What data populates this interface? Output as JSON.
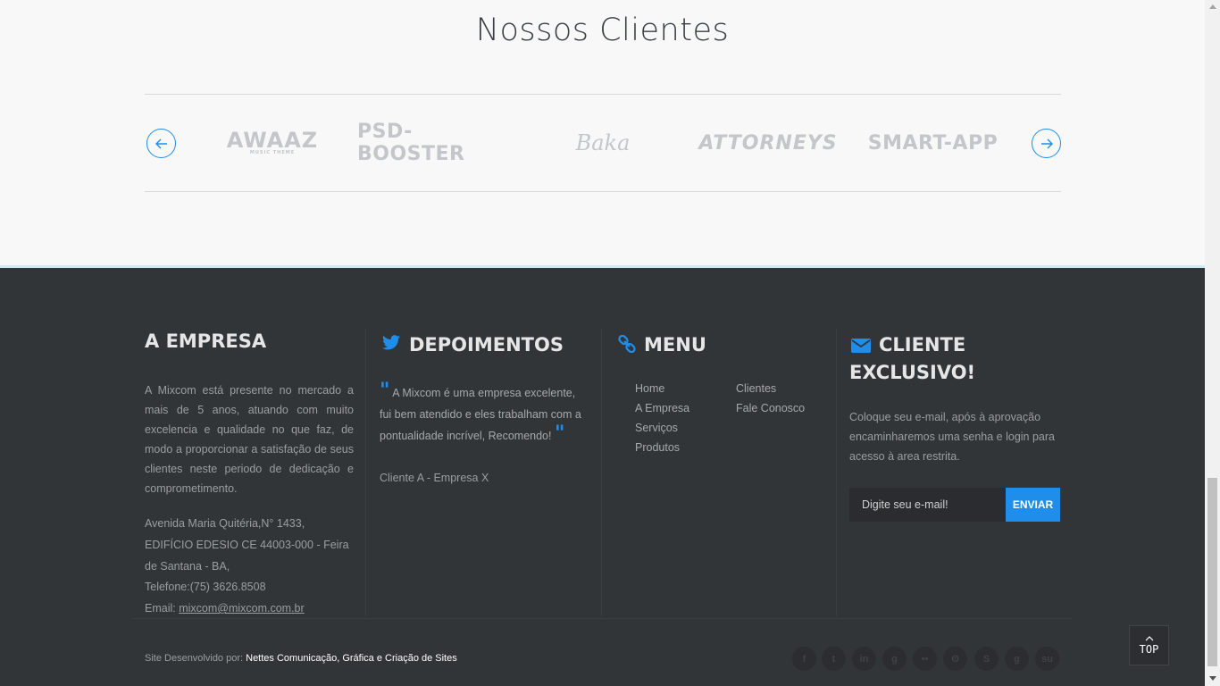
{
  "clients": {
    "title": "Nossos Clientes",
    "logos": {
      "awaaz": "AWAAZ",
      "awaaz_sub": "MUSIC THEME",
      "psd": "PSD-BOOSTER",
      "baka": "Baka",
      "attorneys": "ATTORNEYS",
      "smart": "SMART-APP"
    },
    "accent_color": "#1e8eea"
  },
  "footer": {
    "empresa": {
      "title": "A EMPRESA",
      "text": "A Mixcom está presente no mercado a mais de 5 anos, atuando com muito excelencia e qualidade no que faz, de modo a proporcionar a satisfação de seus clientes neste periodo de dedicação e comprometimento.",
      "address": "Avenida Maria Quitéria,N° 1433, EDIFÍCIO EDESIO CE 44003-000 - Feira de Santana - BA,",
      "phone": "Telefone:(75) 3626.8508",
      "email_label": "Email: ",
      "email": "mixcom@mixcom.com.br"
    },
    "depoimentos": {
      "title": "DEPOIMENTOS",
      "quote": "A Mixcom é uma empresa excelente, fui bem atendido e eles trabalham com a pontualidade incrível, Recomendo!",
      "author": "Cliente A - Empresa X"
    },
    "menu": {
      "title": "MENU",
      "home": "Home",
      "empresa": "A Empresa",
      "servicos": "Serviços",
      "produtos": "Produtos",
      "clientes": "Clientes",
      "contato": "Fale Conosco"
    },
    "exclusivo": {
      "title_line1": "CLIENTE",
      "title_line2": "EXCLUSIVO!",
      "text": "Coloque seu e-mail, após à aprovação encaminharemos uma senha e login para acesso à area restrita.",
      "placeholder": "Digite seu e-mail!",
      "button": "ENVIAR"
    },
    "credit_prefix": "Site Desenvolvido por: ",
    "credit_name": "Nettes Comunicação, Gráfica e Criação de Sites",
    "top_label": "TOP"
  }
}
